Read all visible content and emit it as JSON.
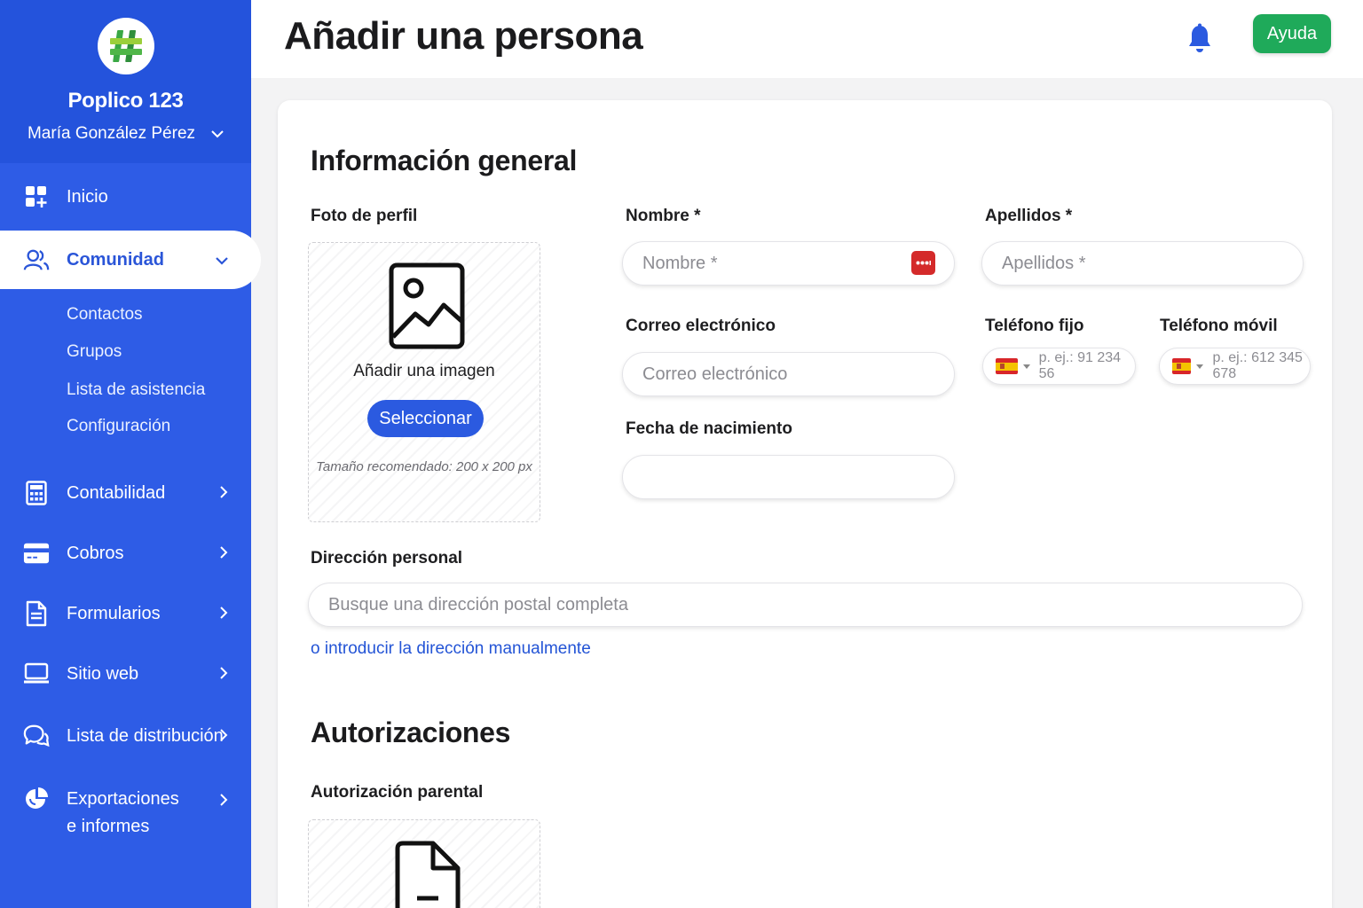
{
  "sidebar": {
    "org_name": "Poplico 123",
    "user_name": "María González Pérez",
    "items": [
      {
        "label": "Inicio",
        "icon": "dashboard-add-icon"
      },
      {
        "label": "Comunidad",
        "icon": "people-icon"
      },
      {
        "label": "Contabilidad",
        "icon": "calculator-icon"
      },
      {
        "label": "Cobros",
        "icon": "credit-card-icon"
      },
      {
        "label": "Formularios",
        "icon": "document-icon"
      },
      {
        "label": "Sitio web",
        "icon": "laptop-icon"
      },
      {
        "label": "Lista de distribución",
        "icon": "chat-bubbles-icon"
      },
      {
        "label_line1": "Exportaciones",
        "label_line2": "e informes",
        "icon": "pie-chart-icon"
      }
    ],
    "subitems": [
      "Contactos",
      "Grupos",
      "Lista de asistencia",
      "Configuración"
    ]
  },
  "header": {
    "title": "Añadir una persona",
    "help_label": "Ayuda"
  },
  "form": {
    "general_title": "Información general",
    "photo": {
      "label": "Foto de perfil",
      "add_text": "Añadir una imagen",
      "select_label": "Seleccionar",
      "hint": "Tamaño recomendado: 200 x 200 px"
    },
    "first_name": {
      "label": "Nombre *",
      "placeholder": "Nombre *"
    },
    "last_name": {
      "label": "Apellidos *",
      "placeholder": "Apellidos *"
    },
    "email": {
      "label": "Correo electrónico",
      "placeholder": "Correo electrónico"
    },
    "landline": {
      "label": "Teléfono fijo",
      "placeholder": "p. ej.: 91 234 56"
    },
    "mobile": {
      "label": "Teléfono móvil",
      "placeholder": "p. ej.: 612 345 678"
    },
    "birthdate": {
      "label": "Fecha de nacimiento",
      "value": ""
    },
    "address": {
      "label": "Dirección personal",
      "placeholder": "Busque una dirección postal completa",
      "manual_link": "o introducir la dirección manualmente"
    },
    "authorizations_title": "Autorizaciones",
    "parental": {
      "label": "Autorización parental"
    }
  },
  "colors": {
    "sidebar": "#2e5ce6",
    "accent": "#2b5ae0",
    "help": "#1faa5a",
    "link": "#2354d6"
  }
}
